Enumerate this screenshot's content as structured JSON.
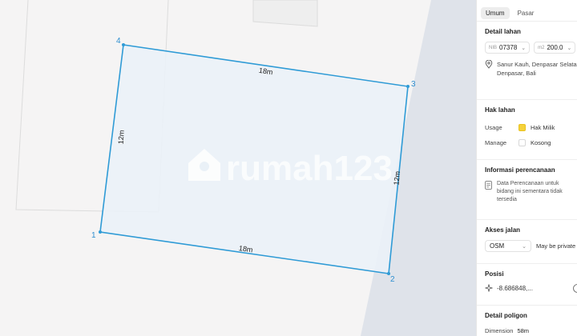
{
  "map": {
    "edges": {
      "top": "18m",
      "right": "12m",
      "bottom": "18m",
      "left": "12m"
    },
    "vertices": [
      "1",
      "2",
      "3",
      "4"
    ],
    "watermark": "rumah123"
  },
  "tabs": [
    {
      "label": "Umum",
      "active": true
    },
    {
      "label": "Pasar",
      "active": false
    }
  ],
  "detail_lahan": {
    "title": "Detail lahan",
    "nib_prefix": "NIB",
    "nib_value": "07378",
    "area_prefix": "m2",
    "area_value": "200.0",
    "address_line1": "Sanur Kauh, Denpasar Selatan",
    "address_line2": "Denpasar, Bali"
  },
  "hak_lahan": {
    "title": "Hak lahan",
    "usage_label": "Usage",
    "usage_value": "Hak Milik",
    "manage_label": "Manage",
    "manage_value": "Kosong",
    "colors": {
      "usage": "#f5d23b"
    }
  },
  "informasi_perencanaan": {
    "title": "Informasi perencanaan",
    "lines": [
      "Data Perencanaan untuk",
      "bidang ini sementara tidak",
      "tersedia"
    ]
  },
  "akses_jalan": {
    "title": "Akses jalan",
    "select_value": "OSM",
    "note": "May be private"
  },
  "posisi": {
    "title": "Posisi",
    "coord": "-8.686848,..."
  },
  "detail_poligon": {
    "title": "Detail poligon",
    "dimension_label": "Dimension",
    "dimension_value": "58m"
  },
  "colors": {
    "polygon_stroke": "#2f9bd6",
    "polygon_fill": "#eaf1f7",
    "road": "#dfe3ea"
  }
}
